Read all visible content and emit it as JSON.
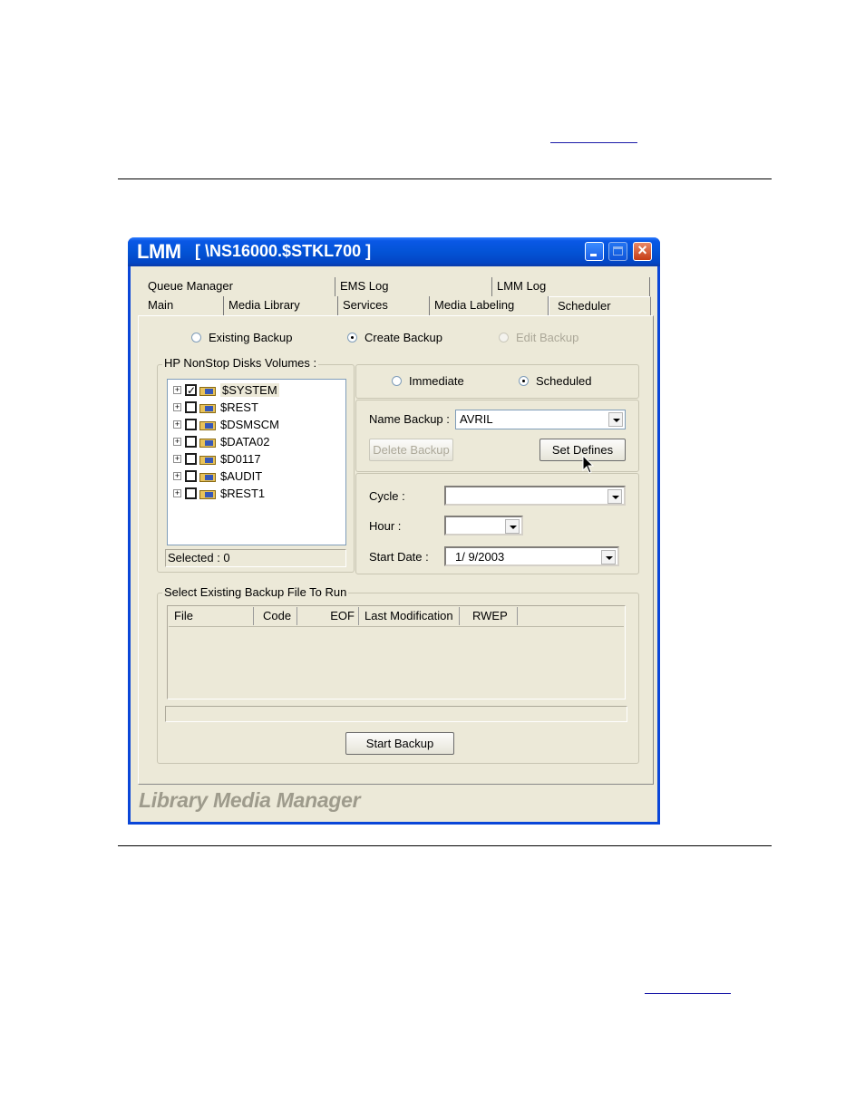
{
  "window": {
    "app_name": "LMM",
    "path": "[ \\NS16000.$STKL700 ]",
    "footer": "Library Media Manager",
    "controls": [
      "minimize-icon",
      "maximize-icon",
      "close-icon"
    ],
    "accent": "#0a46d8"
  },
  "tabs": {
    "row1": [
      "Queue Manager",
      "EMS Log",
      "LMM Log"
    ],
    "row2": [
      "Main",
      "Media Library",
      "Services",
      "Media Labeling",
      "Scheduler"
    ],
    "active": "Scheduler"
  },
  "modes": {
    "existing": "Existing Backup",
    "create": "Create Backup",
    "edit": "Edit Backup",
    "selected": "Create Backup"
  },
  "disks": {
    "legend": "HP NonStop Disks Volumes :",
    "items": [
      {
        "name": "$SYSTEM",
        "checked": true
      },
      {
        "name": "$REST",
        "checked": false
      },
      {
        "name": "$DSMSCM",
        "checked": false
      },
      {
        "name": "$DATA02",
        "checked": false
      },
      {
        "name": "$D0117",
        "checked": false
      },
      {
        "name": "$AUDIT",
        "checked": false
      },
      {
        "name": "$REST1",
        "checked": false
      }
    ],
    "selected_label": "Selected : 0"
  },
  "timing": {
    "immediate": "Immediate",
    "scheduled": "Scheduled",
    "selected": "Scheduled"
  },
  "backup": {
    "name_label": "Name Backup :",
    "name_value": "AVRIL",
    "delete_button": "Delete Backup",
    "set_defines_button": "Set Defines"
  },
  "schedule": {
    "cycle_label": "Cycle :",
    "cycle_value": "",
    "hour_label": "Hour :",
    "hour_value": "",
    "start_label": "Start Date :",
    "start_value": "1/  9/2003"
  },
  "existing_files": {
    "legend": "Select Existing Backup File To Run",
    "columns": [
      "File",
      "Code",
      "EOF",
      "Last Modification",
      "RWEP"
    ]
  },
  "start_button": "Start Backup"
}
